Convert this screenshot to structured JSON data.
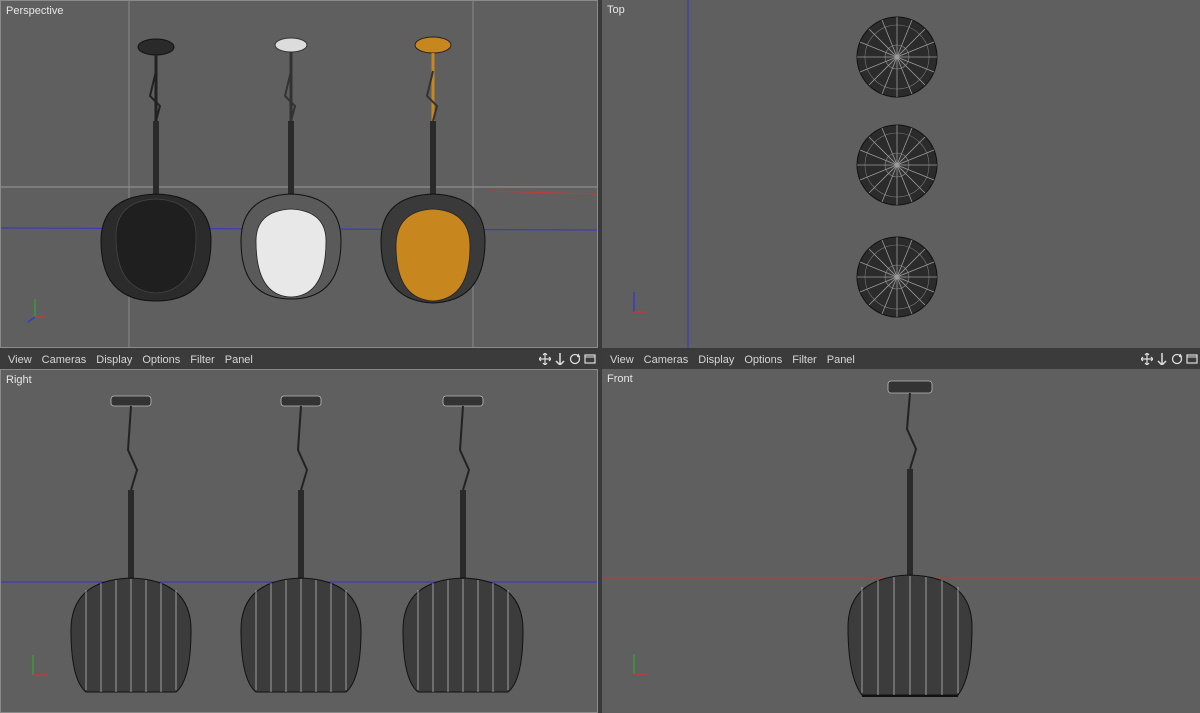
{
  "viewports": {
    "perspective": {
      "label": "Perspective"
    },
    "top": {
      "label": "Top"
    },
    "right": {
      "label": "Right"
    },
    "front": {
      "label": "Front"
    }
  },
  "menu": {
    "items": [
      "View",
      "Cameras",
      "Display",
      "Options",
      "Filter",
      "Panel"
    ]
  },
  "nav_icons": [
    "move-view-icon",
    "dolly-view-icon",
    "rotate-view-icon",
    "maximize-view-icon"
  ],
  "colors": {
    "viewport_bg": "#5f5f5f",
    "axis_x": "#c23a3a",
    "axis_y": "#3a9a3a",
    "axis_z": "#3a3ac2",
    "lamp_black": "#2b2b2b",
    "lamp_white": "#e8e8e8",
    "lamp_orange": "#c8861e"
  }
}
